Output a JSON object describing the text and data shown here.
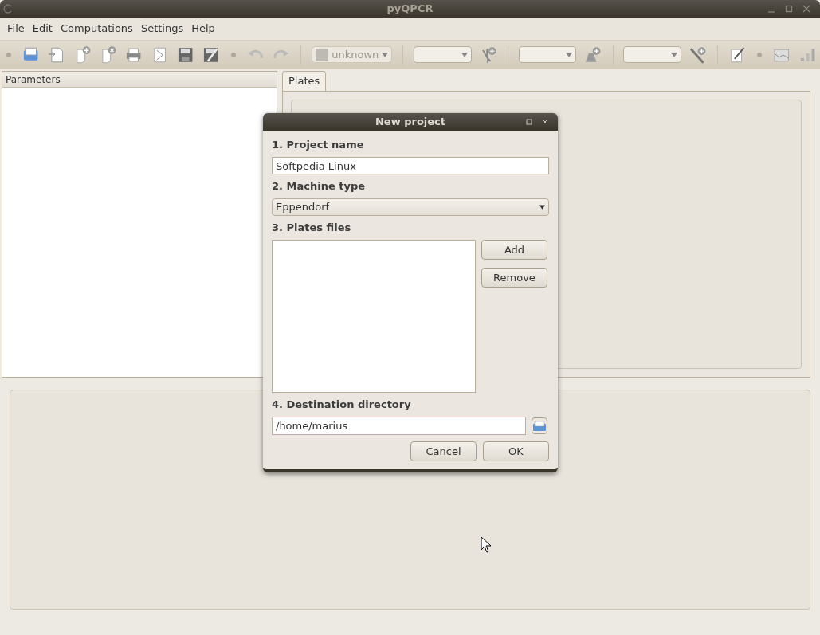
{
  "window": {
    "title": "pyQPCR"
  },
  "menu": [
    "File",
    "Edit",
    "Computations",
    "Settings",
    "Help"
  ],
  "toolbar": {
    "combos": [
      {
        "value": "unknown",
        "disabled": true
      },
      {
        "disabled": false
      },
      {
        "disabled": false
      },
      {
        "disabled": false
      }
    ]
  },
  "parameters_panel": {
    "title": "Parameters"
  },
  "tabs": [
    {
      "label": "Plates",
      "selected": true
    }
  ],
  "dialog": {
    "title": "New project",
    "project_name": {
      "label": "1. Project name",
      "value": "Softpedia Linux"
    },
    "machine_type": {
      "label": "2. Machine type",
      "value": "Eppendorf"
    },
    "plates_files": {
      "label": "3. Plates files",
      "buttons": [
        "Add",
        "Remove"
      ]
    },
    "destination": {
      "label": "4. Destination directory",
      "value": "/home/marius"
    },
    "buttons": [
      "Cancel",
      "OK"
    ]
  }
}
